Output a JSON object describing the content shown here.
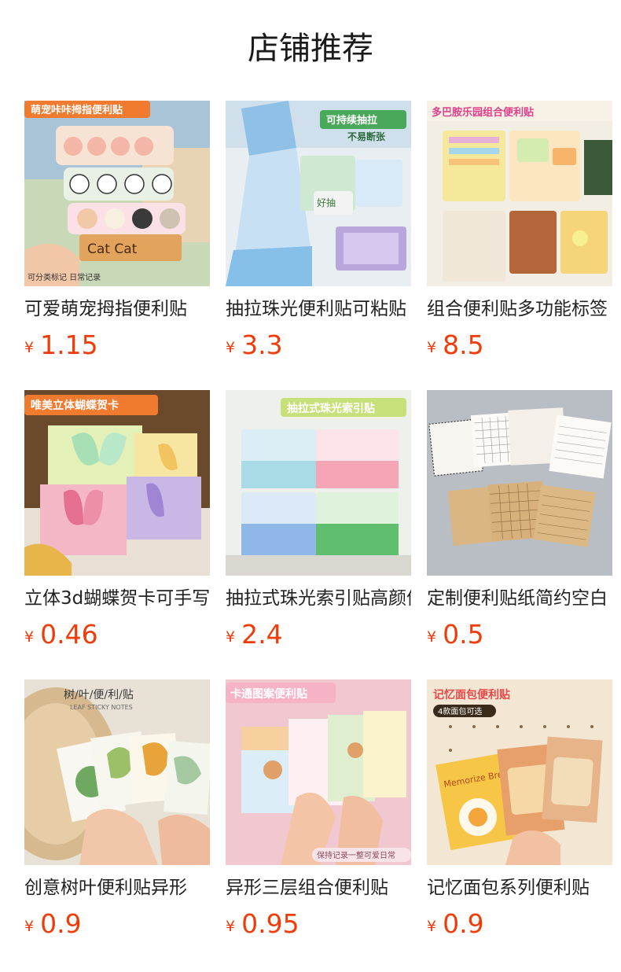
{
  "section_title": "店铺推荐",
  "currency_symbol": "¥",
  "accent_color": "#ee3c0b",
  "products": [
    {
      "name": "可爱萌宠拇指便利贴",
      "price": "1.15",
      "image_banner": "萌宠咔咔拇指便利贴",
      "image_caption": "可分类标记 日常记录",
      "image_label": "Cat Cat"
    },
    {
      "name": "抽拉珠光便利贴可粘贴",
      "price": "3.3",
      "image_banner": "可持续抽拉",
      "image_banner2": "不易断张",
      "image_label": "好抽"
    },
    {
      "name": "组合便利贴多功能标签",
      "price": "8.5",
      "image_banner": "多巴胺乐园组合便利贴"
    },
    {
      "name": "立体3d蝴蝶贺卡可手写",
      "price": "0.46",
      "image_banner": "唯美立体蝴蝶贺卡"
    },
    {
      "name": "抽拉式珠光索引贴高颜值",
      "price": "2.4",
      "image_banner": "抽拉式珠光索引贴"
    },
    {
      "name": "定制便利贴纸简约空白",
      "price": "0.5"
    },
    {
      "name": "创意树叶便利贴异形",
      "price": "0.9",
      "image_banner": "树/叶/便/利/贴",
      "image_sub": "LEAF STICKY NOTES"
    },
    {
      "name": "异形三层组合便利贴",
      "price": "0.95",
      "image_banner": "卡通图案便利贴",
      "image_caption": "保持记录一整可爱日常"
    },
    {
      "name": "记忆面包系列便利贴",
      "price": "0.9",
      "image_banner": "记忆面包便利贴",
      "image_banner2": "4款面包可选",
      "image_label": "Memorize Bread"
    }
  ]
}
